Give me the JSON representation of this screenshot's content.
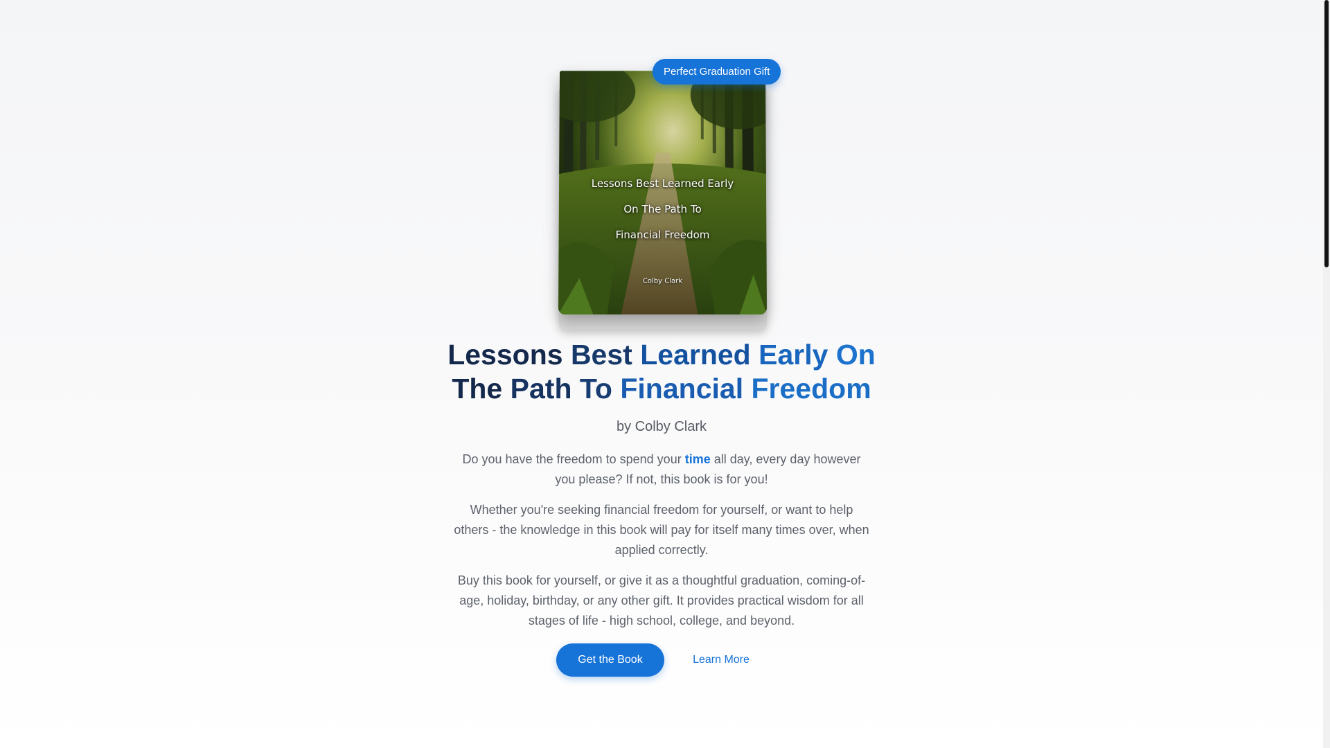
{
  "badge": {
    "label": "Perfect Graduation Gift"
  },
  "book": {
    "cover_title_lines": [
      "Lessons Best Learned Early",
      "On The Path To",
      "Financial Freedom"
    ],
    "cover_author": "Colby Clark"
  },
  "hero": {
    "title_line1": [
      "Lessons",
      "Best",
      "Learned",
      "Early",
      "On"
    ],
    "title_line2": [
      "The",
      "Path",
      "To",
      "Financial",
      "Freedom"
    ],
    "author": "by Colby Clark",
    "paragraph1_before": "Do you have the freedom to spend your ",
    "paragraph1_highlight": "time",
    "paragraph1_after": " all day, every day however you please? If not, this book is for you!",
    "paragraph2": "Whether you're seeking financial freedom for yourself, or want to help others - the knowledge in this book will pay for itself many times over, when applied correctly.",
    "paragraph3": "Buy this book for yourself, or give it as a thoughtful graduation, coming-of-age, holiday, birthday, or any other gift. It provides practical wisdom for all stages of life - high school, college, and beyond."
  },
  "buttons": {
    "primary": "Get the Book",
    "secondary": "Learn More"
  },
  "colors": {
    "accent": "#1673d8",
    "title_dark": "#13284a",
    "body_text": "#5c616a"
  }
}
